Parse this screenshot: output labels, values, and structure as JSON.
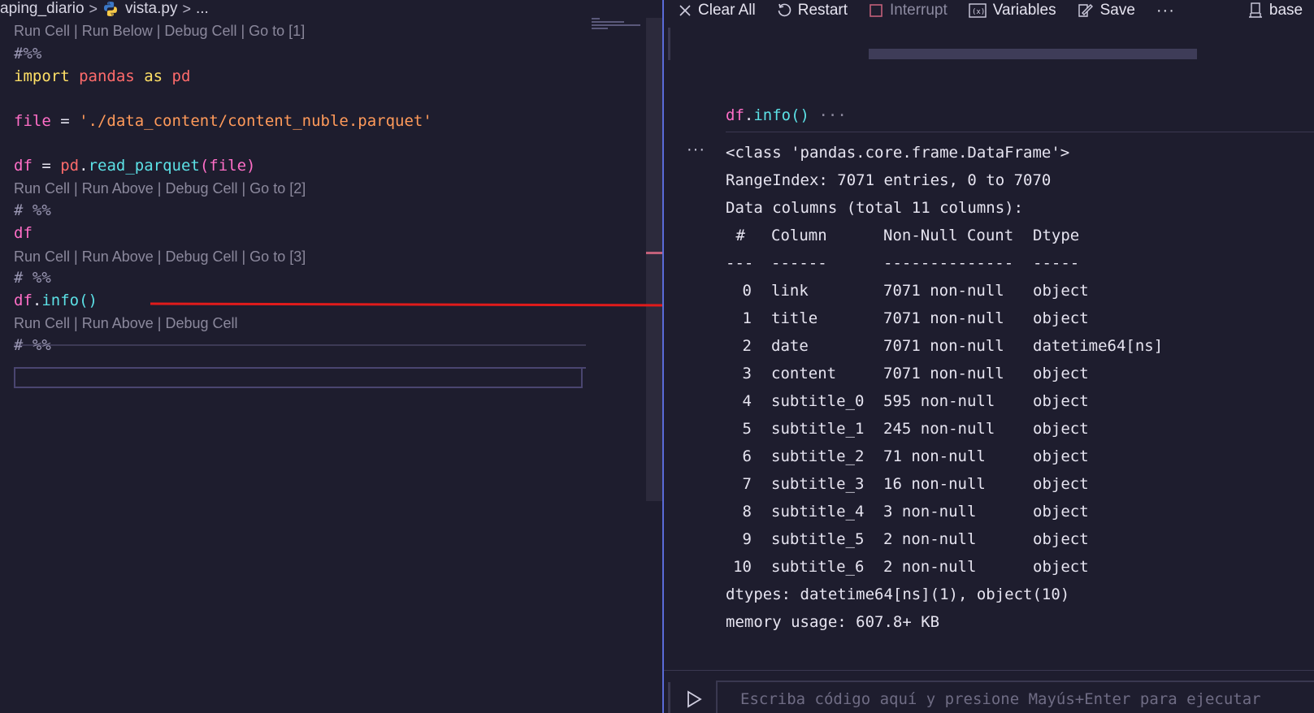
{
  "breadcrumb": {
    "folder": "aping_diario",
    "file": "vista.py",
    "more": "..."
  },
  "editor": {
    "lens_1": "Run Cell | Run Below | Debug Cell | Go to [1]",
    "cell_1_marker": "#%%",
    "import_kw": "import",
    "import_mod": "pandas",
    "as_kw": "as",
    "alias": "pd",
    "file_var": "file",
    "eq": " = ",
    "file_str": "'./data_content/content_nuble.parquet'",
    "df_var": "df",
    "pd": "pd",
    "read_fn": "read_parquet",
    "read_args": "(file)",
    "lens_2": "Run Cell | Run Above | Debug Cell | Go to [2]",
    "cell_2_marker": "# %%",
    "df_line": "df",
    "lens_3": "Run Cell | Run Above | Debug Cell | Go to [3]",
    "cell_3_marker": "# %%",
    "info_obj": "df",
    "info_fn": "info",
    "info_parens": "()",
    "lens_4": "Run Cell | Run Above | Debug Cell",
    "cell_4_marker": "# %%",
    "dot": "."
  },
  "toolbar": {
    "clear_all": "Clear All",
    "restart": "Restart",
    "interrupt": "Interrupt",
    "variables": "Variables",
    "save": "Save",
    "more": "···",
    "kernel": "base"
  },
  "interactive": {
    "input_code_obj": "df",
    "input_code_fn": "info",
    "input_code_parens": "()",
    "input_dots": "···",
    "output_dots": "···",
    "output_header": [
      "<class 'pandas.core.frame.DataFrame'>",
      "RangeIndex: 7071 entries, 0 to 7070",
      "Data columns (total 11 columns):"
    ],
    "table_header": [
      "#",
      "Column",
      "Non-Null Count",
      "Dtype"
    ],
    "table_sep": [
      "---",
      "------",
      "--------------",
      "-----"
    ],
    "rows": [
      [
        "0",
        "link",
        "7071 non-null",
        "object"
      ],
      [
        "1",
        "title",
        "7071 non-null",
        "object"
      ],
      [
        "2",
        "date",
        "7071 non-null",
        "datetime64[ns]"
      ],
      [
        "3",
        "content",
        "7071 non-null",
        "object"
      ],
      [
        "4",
        "subtitle_0",
        "595 non-null",
        "object"
      ],
      [
        "5",
        "subtitle_1",
        "245 non-null",
        "object"
      ],
      [
        "6",
        "subtitle_2",
        "71 non-null",
        "object"
      ],
      [
        "7",
        "subtitle_3",
        "16 non-null",
        "object"
      ],
      [
        "8",
        "subtitle_4",
        "3 non-null",
        "object"
      ],
      [
        "9",
        "subtitle_5",
        "2 non-null",
        "object"
      ],
      [
        "10",
        "subtitle_6",
        "2 non-null",
        "object"
      ]
    ],
    "dtypes": "dtypes: datetime64[ns](1), object(10)",
    "memory": "memory usage: 607.8+ KB",
    "input_placeholder": "Escriba código aquí y presione Mayús+Enter para ejecutar"
  },
  "colors": {
    "accent": "#5a6bd8",
    "arrow": "#e01b1b",
    "keyword": "#ffe066",
    "string": "#ff9a5a",
    "function": "#5ce1e6",
    "variable": "#ff6ec7"
  }
}
